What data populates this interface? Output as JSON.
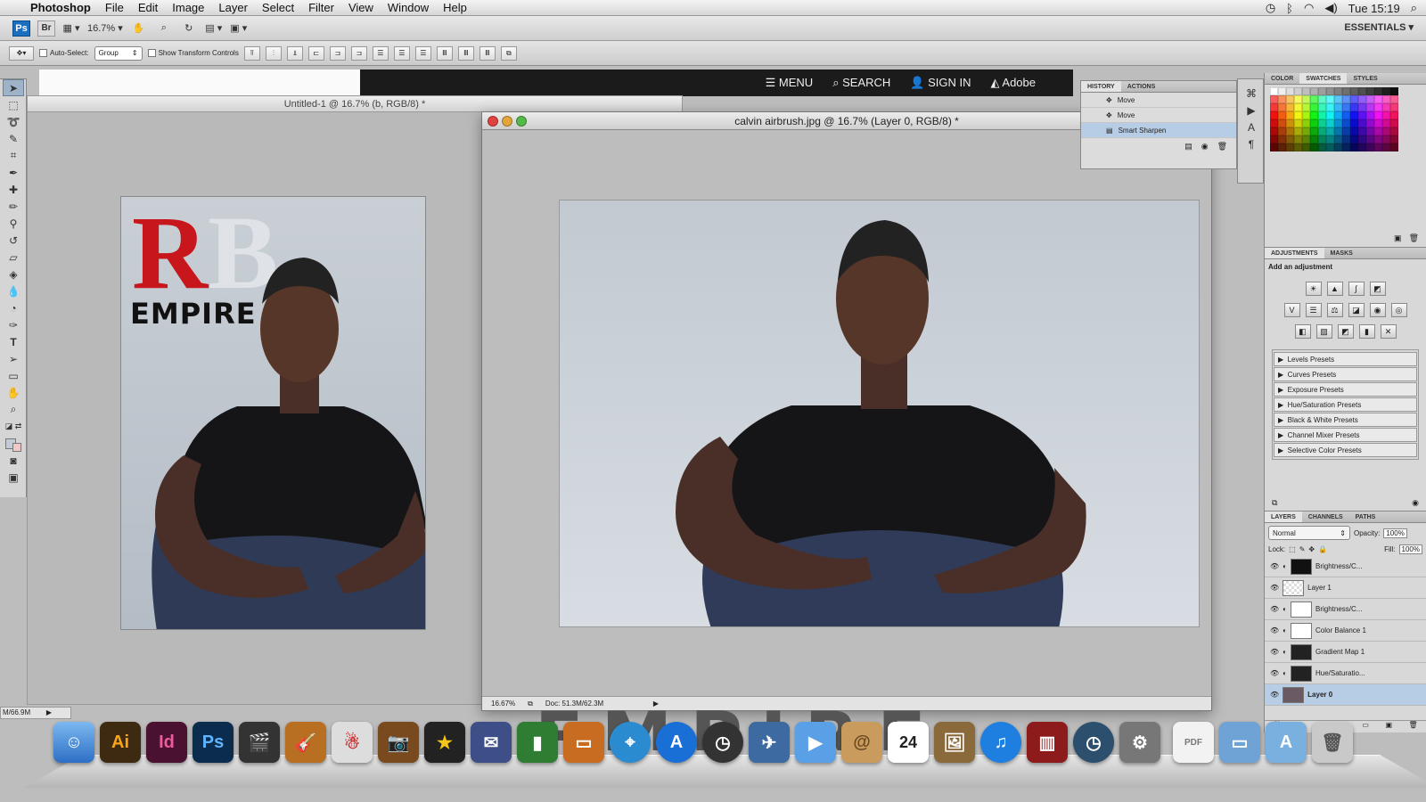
{
  "menubar": {
    "app": "Photoshop",
    "items": [
      "File",
      "Edit",
      "Image",
      "Layer",
      "Select",
      "Filter",
      "View",
      "Window",
      "Help"
    ],
    "clock": "Tue 15:19"
  },
  "appbar": {
    "ps": "Ps",
    "br": "Br",
    "zoom": "16.7%",
    "workspace": "ESSENTIALS ▾"
  },
  "options": {
    "auto_select": "Auto-Select:",
    "auto_select_value": "Group",
    "show_transform": "Show Transform Controls"
  },
  "browser": {
    "menu": "MENU",
    "search": "SEARCH",
    "sign_in": "SIGN IN",
    "adobe": "Adobe"
  },
  "doc1": {
    "title": "Untitled-1 @ 16.7% (b, RGB/8) *",
    "logo_r": "R",
    "logo_b": "B",
    "logo_text": "EMPIRE",
    "status": "M/66.9M"
  },
  "doc2": {
    "title": "calvin airbrush.jpg @ 16.7% (Layer 0, RGB/8) *",
    "zoom": "16.67%",
    "doc_size": "Doc: 51.3M/62.3M"
  },
  "history": {
    "tabs": [
      "HISTORY",
      "ACTIONS"
    ],
    "items": [
      "Move",
      "Move",
      "Smart Sharpen"
    ]
  },
  "swatches": {
    "tabs": [
      "COLOR",
      "SWATCHES",
      "STYLES"
    ]
  },
  "adjustments": {
    "tabs": [
      "ADJUSTMENTS",
      "MASKS"
    ],
    "heading": "Add an adjustment",
    "presets": [
      "Levels Presets",
      "Curves Presets",
      "Exposure Presets",
      "Hue/Saturation Presets",
      "Black & White Presets",
      "Channel Mixer Presets",
      "Selective Color Presets"
    ]
  },
  "layers": {
    "tabs": [
      "LAYERS",
      "CHANNELS",
      "PATHS"
    ],
    "blend": "Normal",
    "opacity_label": "Opacity:",
    "opacity": "100%",
    "lock_label": "Lock:",
    "fill_label": "Fill:",
    "fill": "100%",
    "items": [
      "Brightness/C...",
      "Layer 1",
      "Brightness/C...",
      "Color Balance 1",
      "Gradient Map 1",
      "Hue/Saturatio...",
      "Layer 0"
    ]
  },
  "dock": {
    "ai": "Ai",
    "id": "Id",
    "ps": "Ps",
    "cal": "24"
  },
  "background_text": "EMPIRE"
}
